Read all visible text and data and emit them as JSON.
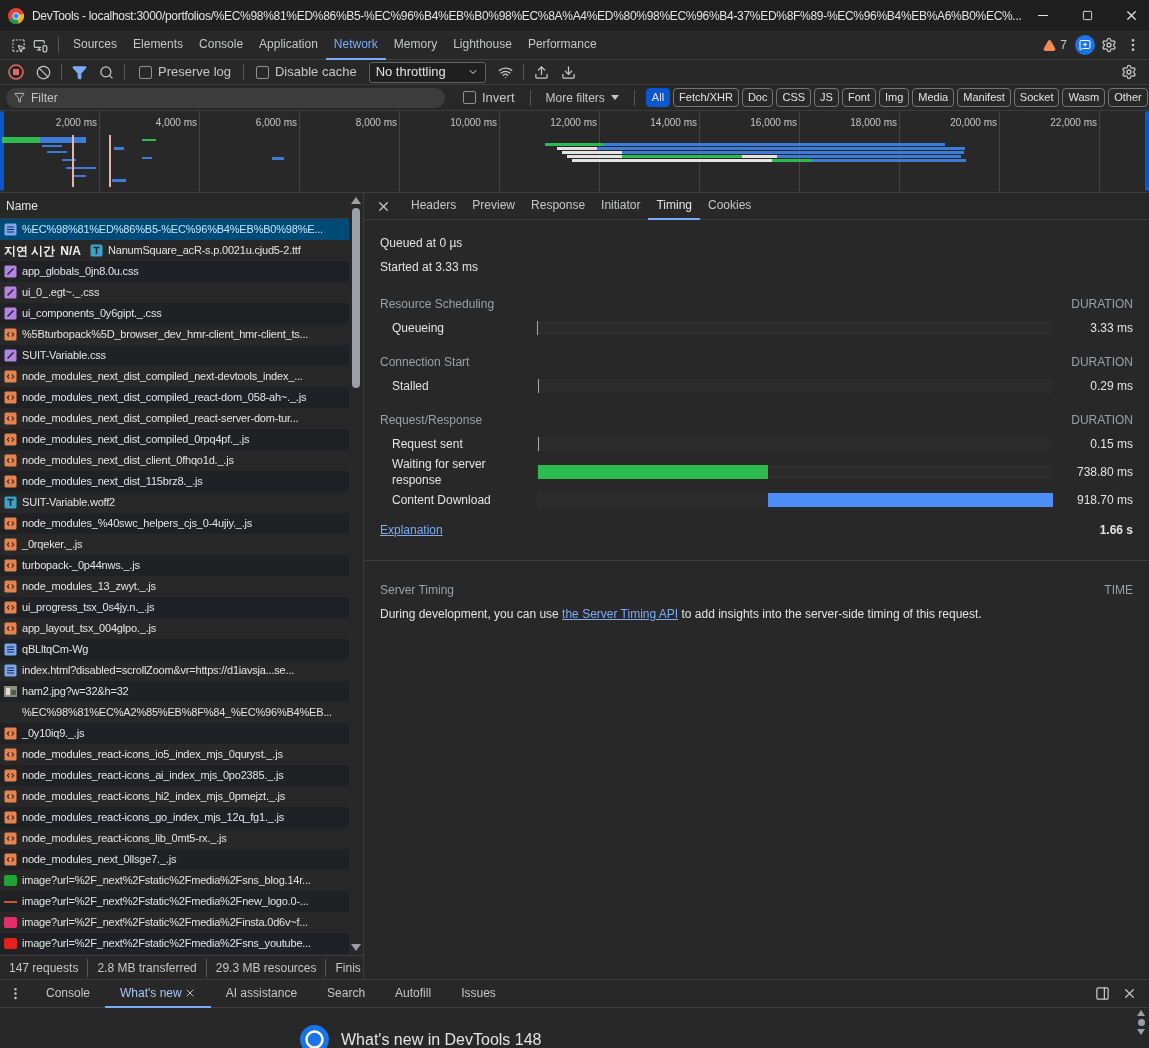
{
  "window": {
    "title": "DevTools - localhost:3000/portfolios/%EC%98%81%ED%86%B5-%EC%96%B4%EB%B0%98%EC%8A%A4%ED%80%98%EC%96%B4-37%ED%8F%89-%EC%96%B4%EB%A6%B0%EC%..."
  },
  "panel_tabs": [
    {
      "label": "Sources",
      "selected": false
    },
    {
      "label": "Elements",
      "selected": false
    },
    {
      "label": "Console",
      "selected": false
    },
    {
      "label": "Application",
      "selected": false
    },
    {
      "label": "Network",
      "selected": true
    },
    {
      "label": "Memory",
      "selected": false
    },
    {
      "label": "Lighthouse",
      "selected": false
    },
    {
      "label": "Performance",
      "selected": false
    }
  ],
  "warnings": "7",
  "toolbar": {
    "preserve_log": {
      "label": "Preserve log",
      "checked": false
    },
    "disable_cache": {
      "label": "Disable cache",
      "checked": false
    },
    "throttling": "No throttling"
  },
  "filter": {
    "placeholder": "Filter",
    "invert": {
      "label": "Invert",
      "checked": false
    },
    "more_filters": "More filters",
    "types": [
      {
        "label": "All",
        "selected": true
      },
      {
        "label": "Fetch/XHR",
        "selected": false
      },
      {
        "label": "Doc",
        "selected": false
      },
      {
        "label": "CSS",
        "selected": false
      },
      {
        "label": "JS",
        "selected": false
      },
      {
        "label": "Font",
        "selected": false
      },
      {
        "label": "Img",
        "selected": false
      },
      {
        "label": "Media",
        "selected": false
      },
      {
        "label": "Manifest",
        "selected": false
      },
      {
        "label": "Socket",
        "selected": false
      },
      {
        "label": "Wasm",
        "selected": false
      },
      {
        "label": "Other",
        "selected": false
      }
    ]
  },
  "overview": {
    "ticks": [
      "2,000 ms",
      "4,000 ms",
      "6,000 ms",
      "8,000 ms",
      "10,000 ms",
      "12,000 ms",
      "14,000 ms",
      "16,000 ms",
      "18,000 ms",
      "20,000 ms",
      "22,000 ms"
    ]
  },
  "requests": {
    "column": "Name",
    "rows": [
      {
        "name": "%EC%98%81%ED%86%B5-%EC%96%B4%EB%B0%98%E...",
        "kind": "doc",
        "selected": true
      },
      {
        "name": "NanumSquare_acR-s.p.0021u.cjud5-2.ttf",
        "kind": "font",
        "selected": false
      },
      {
        "name": "app_globals_0jn8.0u.css",
        "kind": "css",
        "selected": false
      },
      {
        "name": "ui_0_.egt~._.css",
        "kind": "css",
        "selected": false
      },
      {
        "name": "ui_components_0y6gipt._.css",
        "kind": "css",
        "selected": false
      },
      {
        "name": "%5Bturbopack%5D_browser_dev_hmr-client_hmr-client_ts...",
        "kind": "script",
        "selected": false
      },
      {
        "name": "SUIT-Variable.css",
        "kind": "css",
        "selected": false
      },
      {
        "name": "node_modules_next_dist_compiled_next-devtools_index_...",
        "kind": "script",
        "selected": false
      },
      {
        "name": "node_modules_next_dist_compiled_react-dom_058-ah~._.js",
        "kind": "script",
        "selected": false
      },
      {
        "name": "node_modules_next_dist_compiled_react-server-dom-tur...",
        "kind": "script",
        "selected": false
      },
      {
        "name": "node_modules_next_dist_compiled_0rpq4pf._.js",
        "kind": "script",
        "selected": false
      },
      {
        "name": "node_modules_next_dist_client_0fhqo1d._.js",
        "kind": "script",
        "selected": false
      },
      {
        "name": "node_modules_next_dist_115brz8._.js",
        "kind": "script",
        "selected": false
      },
      {
        "name": "SUIT-Variable.woff2",
        "kind": "font",
        "selected": false
      },
      {
        "name": "node_modules_%40swc_helpers_cjs_0-4ujiy._.js",
        "kind": "script",
        "selected": false
      },
      {
        "name": "_0rqeker._.js",
        "kind": "script",
        "selected": false
      },
      {
        "name": "turbopack-_0p44nws._.js",
        "kind": "script",
        "selected": false
      },
      {
        "name": "node_modules_13_zwyt._.js",
        "kind": "script",
        "selected": false
      },
      {
        "name": "ui_progress_tsx_0s4jy.n._.js",
        "kind": "script",
        "selected": false
      },
      {
        "name": "app_layout_tsx_004glpo._.js",
        "kind": "script",
        "selected": false
      },
      {
        "name": "qBLltqCm-Wg",
        "kind": "doc",
        "selected": false
      },
      {
        "name": "index.html?disabled=scrollZoom&vr=https://d1iavsja...se...",
        "kind": "doc",
        "selected": false
      },
      {
        "name": "ham2.jpg?w=32&h=32",
        "kind": "thumb",
        "selected": false
      },
      {
        "name": "%EC%98%81%EC%A2%85%EB%8F%84_%EC%96%B4%EB...",
        "kind": "blank",
        "selected": false
      },
      {
        "name": "_0y10iq9._.js",
        "kind": "script",
        "selected": false
      },
      {
        "name": "node_modules_react-icons_io5_index_mjs_0quryst._.js",
        "kind": "script",
        "selected": false
      },
      {
        "name": "node_modules_react-icons_ai_index_mjs_0po2385._.js",
        "kind": "script",
        "selected": false
      },
      {
        "name": "node_modules_react-icons_hi2_index_mjs_0pmejzt._.js",
        "kind": "script",
        "selected": false
      },
      {
        "name": "node_modules_react-icons_go_index_mjs_12q_fg1._.js",
        "kind": "script",
        "selected": false
      },
      {
        "name": "node_modules_react-icons_lib_0mt5-rx._.js",
        "kind": "script",
        "selected": false
      },
      {
        "name": "node_modules_next_0llsge7._.js",
        "kind": "script",
        "selected": false
      },
      {
        "name": "image?url=%2F_next%2Fstatic%2Fmedia%2Fsns_blog.14r...",
        "kind": "image",
        "color": "#1fa336",
        "selected": false
      },
      {
        "name": "image?url=%2F_next%2Fstatic%2Fmedia%2Fnew_logo.0-...",
        "kind": "line",
        "color": "#c8562e",
        "selected": false
      },
      {
        "name": "image?url=%2F_next%2Fstatic%2Fmedia%2Finsta.0d6v~f...",
        "kind": "image",
        "color": "#e1306c",
        "selected": false
      },
      {
        "name": "image?url=%2F_next%2Fstatic%2Fmedia%2Fsns_youtube...",
        "kind": "image",
        "color": "#e52020",
        "selected": false
      }
    ]
  },
  "page_overlay": {
    "label": "지연 시간",
    "value": "N/A"
  },
  "status_bar": [
    "147 requests",
    "2.8 MB transferred",
    "29.3 MB resources",
    "Finis"
  ],
  "detail_tabs": [
    {
      "label": "Headers",
      "selected": false
    },
    {
      "label": "Preview",
      "selected": false
    },
    {
      "label": "Response",
      "selected": false
    },
    {
      "label": "Initiator",
      "selected": false
    },
    {
      "label": "Timing",
      "selected": true
    },
    {
      "label": "Cookies",
      "selected": false
    }
  ],
  "timing": {
    "queued": "Queued at 0 µs",
    "started": "Started at 3.33 ms",
    "sections": [
      {
        "title": "Resource Scheduling",
        "column": "DURATION",
        "rows": [
          {
            "label": "Queueing",
            "kind": "tick",
            "level": 0.002,
            "value": "3.33 ms"
          }
        ]
      },
      {
        "title": "Connection Start",
        "column": "DURATION",
        "rows": [
          {
            "label": "Stalled",
            "kind": "tick",
            "level": 0.0002,
            "value": "0.29 ms"
          }
        ]
      },
      {
        "title": "Request/Response",
        "column": "DURATION",
        "rows": [
          {
            "label": "Request sent",
            "kind": "tick",
            "level": 0.0001,
            "value": "0.15 ms"
          },
          {
            "label": "Waiting for server response",
            "kind": "waiting",
            "level": 0.446,
            "value": "738.80 ms"
          },
          {
            "label": "Content Download",
            "kind": "download",
            "level": 0.554,
            "value": "918.70 ms"
          }
        ]
      }
    ],
    "explanation": "Explanation",
    "total": "1.66 s",
    "server_timing": {
      "title": "Server Timing",
      "column": "TIME",
      "before": "During development, you can use ",
      "link": "the Server Timing API",
      "after": " to add insights into the server-side timing of this request."
    }
  },
  "drawer": {
    "tabs": [
      {
        "label": "Console",
        "selected": false
      },
      {
        "label": "What's new",
        "selected": true
      },
      {
        "label": "AI assistance",
        "selected": false
      },
      {
        "label": "Search",
        "selected": false
      },
      {
        "label": "Autofill",
        "selected": false
      },
      {
        "label": "Issues",
        "selected": false
      }
    ],
    "heading": "What's new in DevTools 148"
  }
}
